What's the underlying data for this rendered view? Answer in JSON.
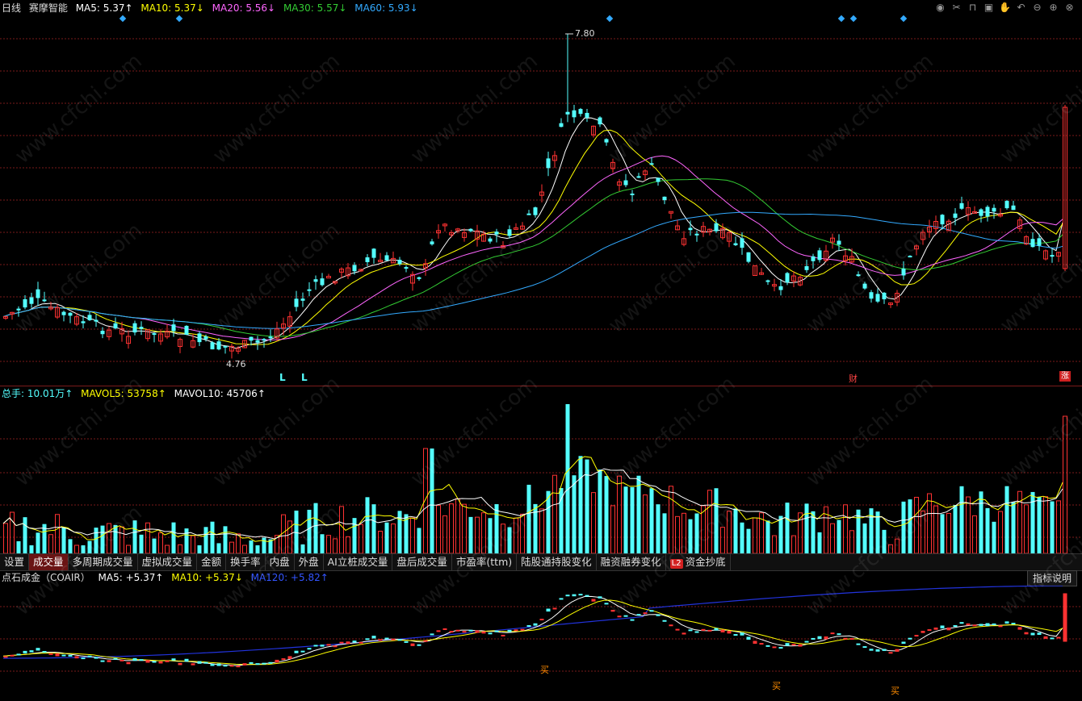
{
  "main": {
    "period": "日线",
    "stock_name": "赛摩智能",
    "ma5": {
      "label": "MA5: 5.37↑",
      "color": "#ffffff"
    },
    "ma10": {
      "label": "MA10: 5.37↓",
      "color": "#ffff00"
    },
    "ma20": {
      "label": "MA20: 5.56↓",
      "color": "#ff66ff"
    },
    "ma30": {
      "label": "MA30: 5.57↓",
      "color": "#33cc33"
    },
    "ma60": {
      "label": "MA60: 5.93↓",
      "color": "#33aaff"
    },
    "high_label": "7.80",
    "low_label": "4.76",
    "marker_cai": "财",
    "marker_zhang": "涨",
    "marker_L1": "L",
    "marker_L2": "L"
  },
  "volume": {
    "total": "总手: 10.01万↑",
    "mavol5": "MAVOL5: 53758↑",
    "mavol10": "MAVOL10: 45706↑"
  },
  "tabs": [
    "设置",
    "成交量",
    "多周期成交量",
    "虚拟成交量",
    "金额",
    "换手率",
    "内盘",
    "外盘",
    "AI立桩成交量",
    "盘后成交量",
    "市盈率(ttm)",
    "陆股通持股变化",
    "融资融券变化"
  ],
  "tab_l2_badge": "L2",
  "tab_l2_label": "资金抄底",
  "indicator": {
    "name": "点石成金（COAIR）",
    "ma5": "MA5: +5.37↑",
    "ma10": "MA10: +5.37↓",
    "ma120": "MA120: +5.82↑",
    "help_button": "指标说明",
    "buy_labels": [
      "买",
      "买",
      "买"
    ]
  },
  "toolbar_icons": [
    "eye-icon",
    "scissors-icon",
    "unlock-icon",
    "lock-icon",
    "hand-icon",
    "undo-icon",
    "zoom-out-icon",
    "zoom-in-icon",
    "close-icon"
  ],
  "watermark": "www.cfchi.com",
  "colors": {
    "up": "#ff3232",
    "down": "#54ffff",
    "grid": "#7a1a1a"
  },
  "chart_data": {
    "type": "candlestick",
    "price_axis_labels": {
      "high": 7.8,
      "low": 4.76
    },
    "ma_values": {
      "MA5": 5.37,
      "MA10": 5.37,
      "MA20": 5.56,
      "MA30": 5.57,
      "MA60": 5.93
    },
    "volume_values": {
      "total_wan": 10.01,
      "MAVOL5": 53758,
      "MAVOL10": 45706
    }
  }
}
